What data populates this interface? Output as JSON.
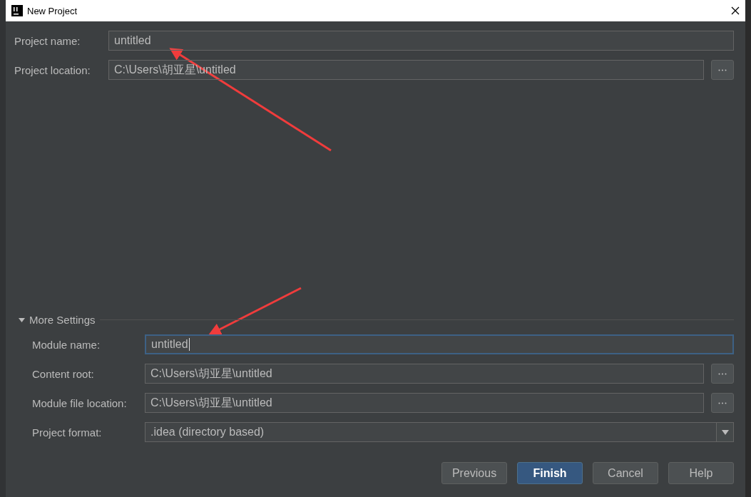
{
  "window": {
    "title": "New Project"
  },
  "project_fields": [
    {
      "label": "Project name:",
      "value": "untitled",
      "browse": false
    },
    {
      "label": "Project location:",
      "value": "C:\\Users\\胡亚星\\untitled",
      "browse": true
    }
  ],
  "more_settings": {
    "label": "More Settings",
    "expanded": true,
    "fields": [
      {
        "kind": "text",
        "label": "Module name:",
        "value": "untitled",
        "focused": true,
        "browse": false
      },
      {
        "kind": "text",
        "label": "Content root:",
        "value": "C:\\Users\\胡亚星\\untitled",
        "focused": false,
        "browse": true
      },
      {
        "kind": "text",
        "label": "Module file location:",
        "value": "C:\\Users\\胡亚星\\untitled",
        "focused": false,
        "browse": true
      },
      {
        "kind": "select",
        "label": "Project format:",
        "value": ".idea (directory based)",
        "browse": false
      }
    ]
  },
  "buttons": [
    {
      "label": "Previous",
      "default": false
    },
    {
      "label": "Finish",
      "default": true
    },
    {
      "label": "Cancel",
      "default": false
    },
    {
      "label": "Help",
      "default": false
    }
  ]
}
